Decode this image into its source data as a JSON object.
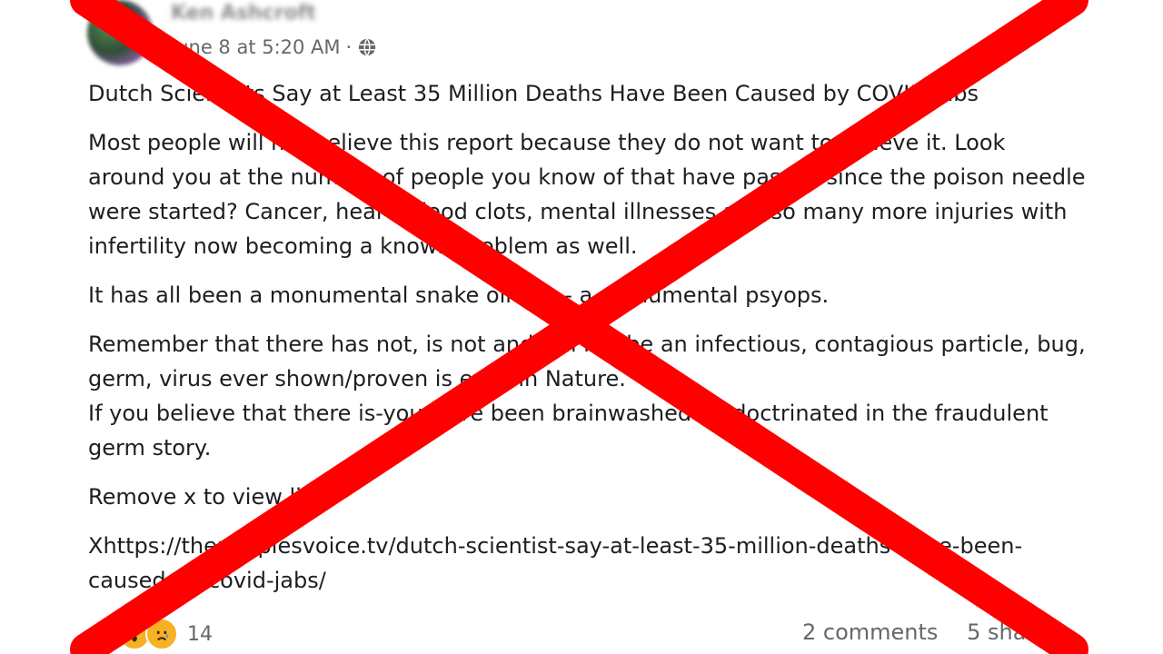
{
  "post": {
    "author": "Ken Ashcroft",
    "timestamp": "June 8 at 5:20 AM",
    "separator": "·",
    "audience_icon": "globe-icon",
    "title": "Dutch Scientists Say at Least 35 Million Deaths Have Been Caused by COVID Jabs",
    "paragraph_1": "Most people will not believe this report because they do not want to believe it. Look around you at the number of people you know of that have passed since the poison needle were started? Cancer, heart, blood clots, mental illnesses and so many more injuries with infertility now becoming a known problem as well.",
    "paragraph_2": "It has all been a monumental snake oil con - a monumental psyops.",
    "paragraph_3_line_1": "Remember that there has not, is not and will not be an infectious, contagious particle, bug, germ, virus ever shown/proven is exist in Nature.",
    "paragraph_3_line_2": "If you believe that there is-you have been brainwashed / indoctrinated in the fraudulent germ story.",
    "paragraph_4": "Remove x to view link",
    "link": "Xhttps://thepeoplesvoice.tv/dutch-scientist-say-at-least-35-million-deaths-have-been-caused-by-covid-jabs/"
  },
  "footer": {
    "reaction_icons": [
      "like-icon",
      "wow-icon",
      "sad-icon"
    ],
    "reaction_count": "14",
    "comments": "2 comments",
    "shares": "5 shares"
  },
  "overlay": {
    "cross_color": "#ff0000"
  }
}
